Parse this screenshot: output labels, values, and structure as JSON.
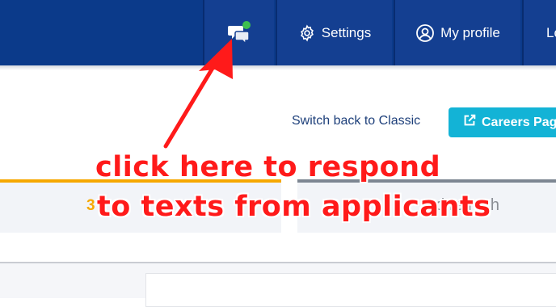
{
  "nav": {
    "settings_label": "Settings",
    "profile_label": "My profile",
    "logout_label": "Lo"
  },
  "toolbar": {
    "switch_label": "Switch back to Classic",
    "careers_label": "Careers Pag"
  },
  "panels": {
    "left_value": "3",
    "right_text": "ed refresh"
  },
  "annotation": {
    "line1": "click here to respond",
    "line2": "to texts from applicants"
  },
  "colors": {
    "topbar": "#0b3a8a",
    "accent_cyan": "#13b3d6",
    "panel_orange": "#f6a800",
    "annotation_red": "#ff1a1a",
    "chat_badge_green": "#3dbf4f"
  }
}
